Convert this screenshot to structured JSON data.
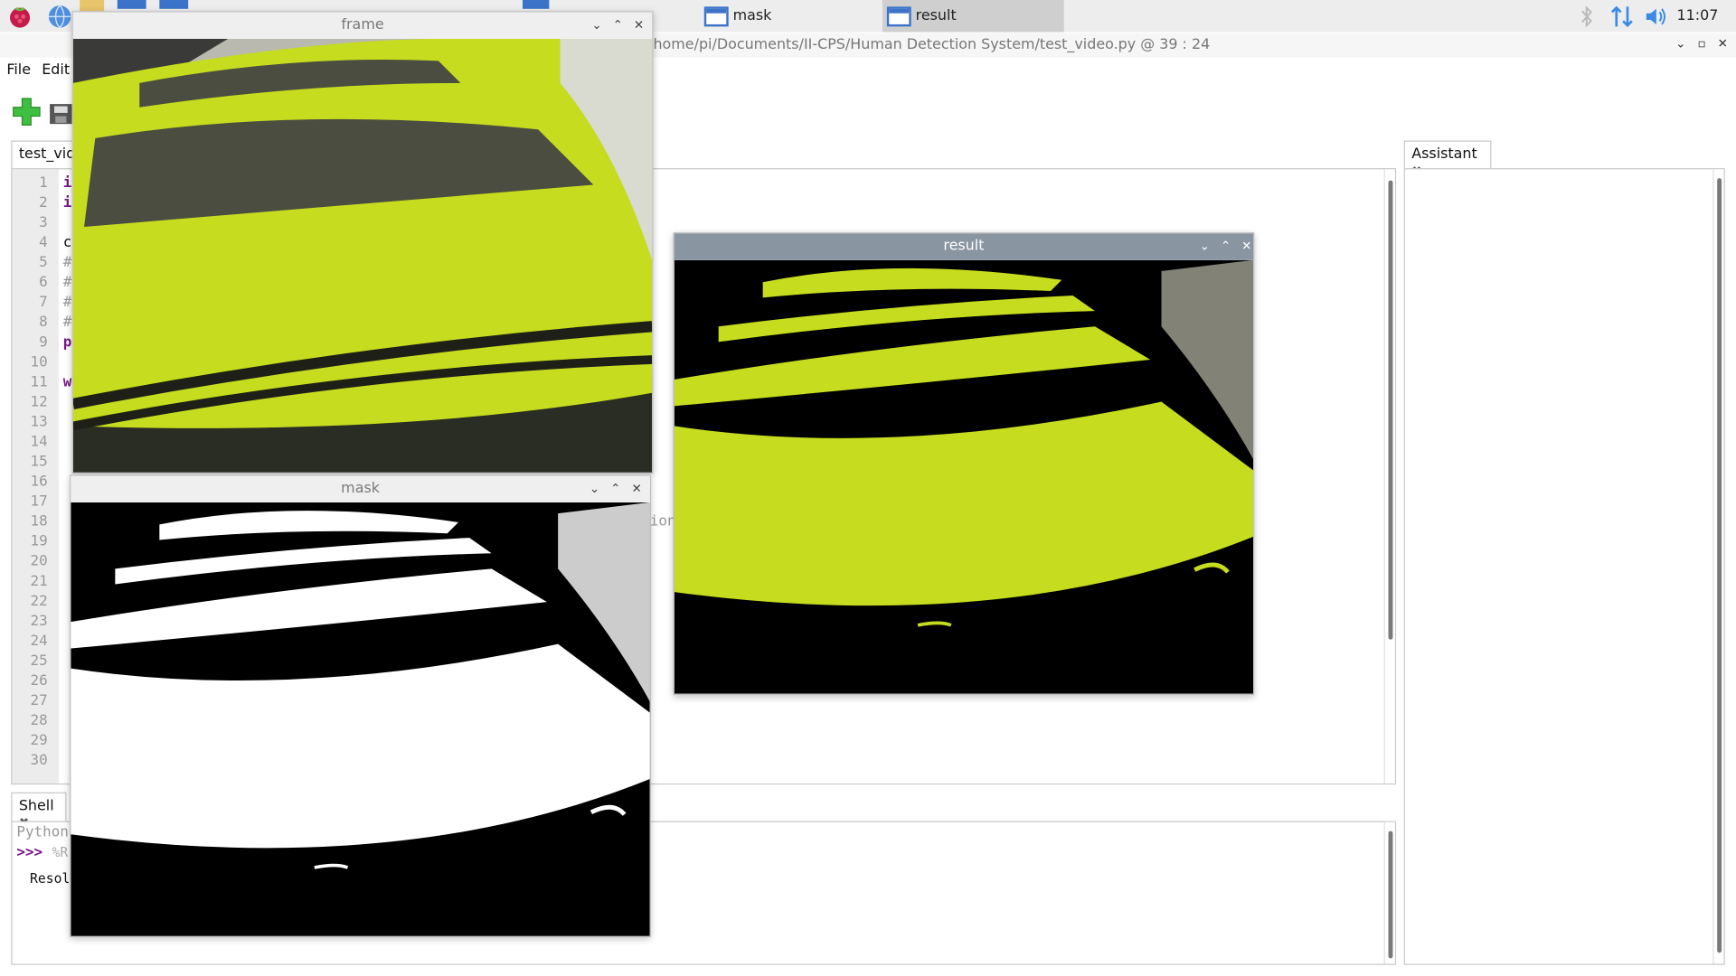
{
  "taskbar": {
    "tasks": [
      {
        "label": "mask",
        "active": false
      },
      {
        "label": "result",
        "active": true
      }
    ],
    "clock": "11:07"
  },
  "thonny": {
    "title": "home/pi/Documents/II-CPS/Human Detection System/test_video.py  @  39 : 24",
    "menu": [
      "File",
      "Edit"
    ],
    "editor_tab": "test_vide",
    "line_numbers": [
      "1",
      "2",
      "3",
      "4",
      "5",
      "6",
      "7",
      "8",
      "9",
      "10",
      "11",
      "12",
      "13",
      "14",
      "15",
      "16",
      "17",
      "18",
      "19",
      "20",
      "21",
      "22",
      "23",
      "24",
      "25",
      "26",
      "27",
      "28",
      "29",
      "30"
    ],
    "code_first_chars": [
      "i",
      "i",
      "",
      "c",
      "#",
      "#",
      "#",
      "#",
      "p",
      "",
      "w"
    ],
    "code_fragment_right": "ion",
    "shell_tab": "Shell",
    "shell_lines": [
      "Python",
      ">>>",
      "Resol"
    ],
    "shell_prompt_tail": "%R",
    "assistant_tab": "Assistant"
  },
  "windows": {
    "frame": {
      "title": "frame"
    },
    "mask": {
      "title": "mask"
    },
    "result": {
      "title": "result"
    }
  },
  "colors": {
    "vest_yellow": "#c6dc1e",
    "stripe_gray": "#4a4d40",
    "python_purple": "#7a1a8a",
    "accent_blue": "#3b73c9"
  }
}
